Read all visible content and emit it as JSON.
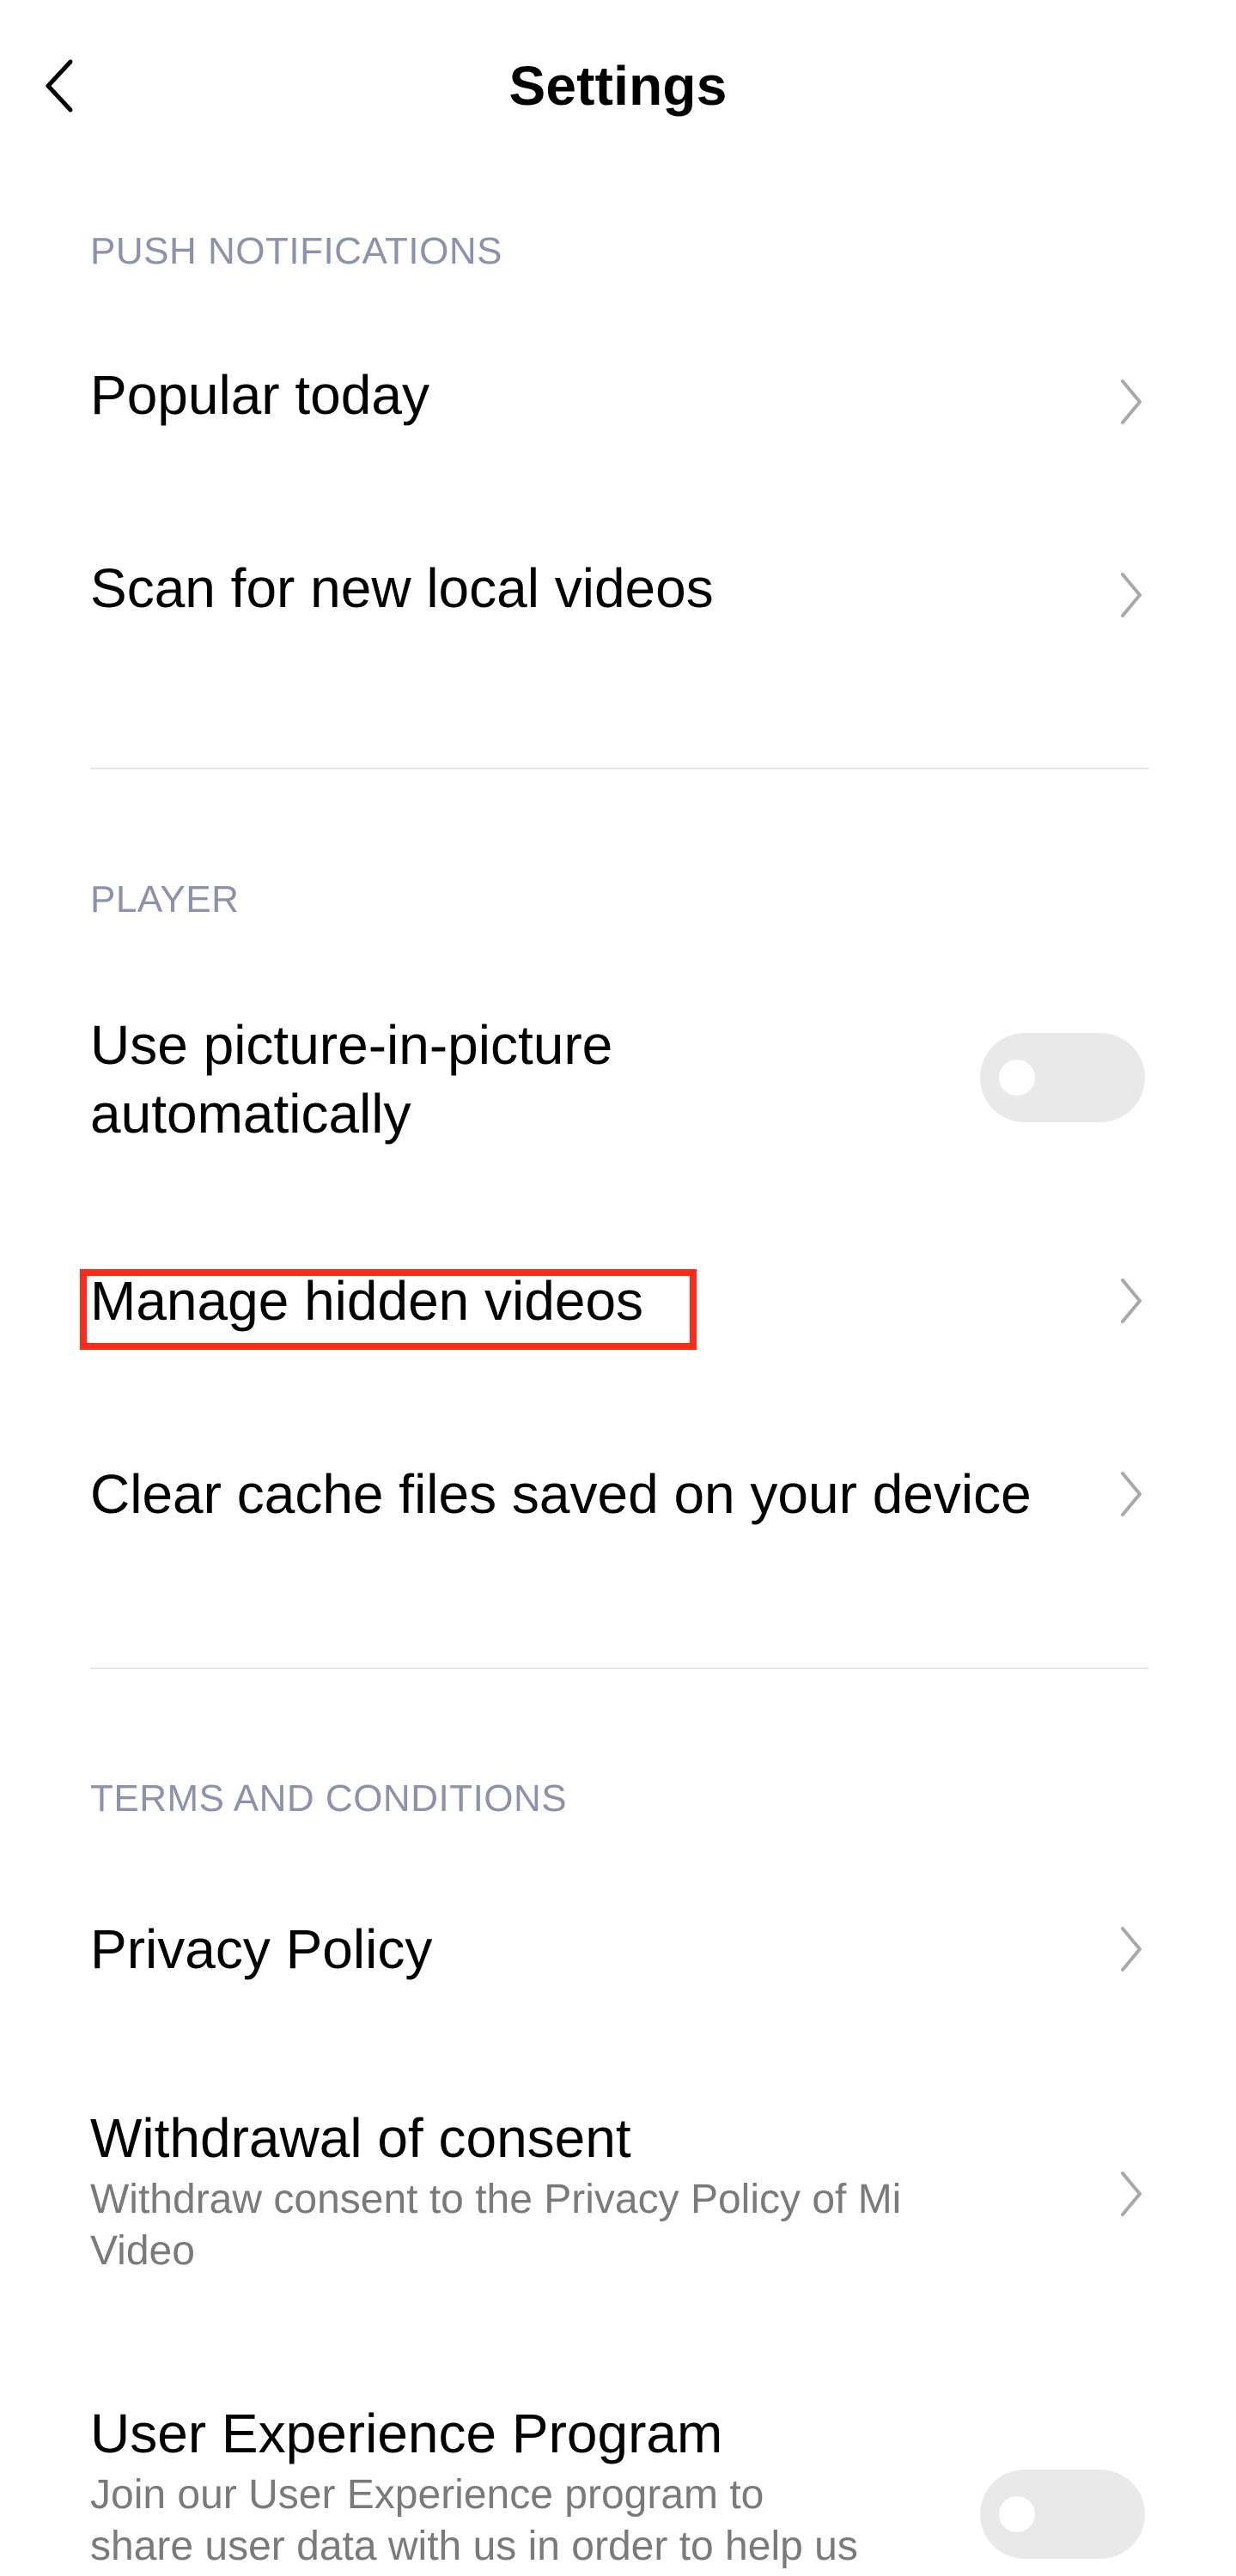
{
  "header": {
    "title": "Settings"
  },
  "sections": {
    "push": {
      "label": "PUSH NOTIFICATIONS",
      "items": [
        {
          "title": "Popular today"
        },
        {
          "title": "Scan for new local videos"
        }
      ]
    },
    "player": {
      "label": "PLAYER",
      "items": [
        {
          "title": "Use picture-in-picture automatically",
          "line1": "Use picture-in-picture",
          "line2": "automatically",
          "toggle": "off"
        },
        {
          "title": "Manage hidden videos"
        },
        {
          "title": "Clear cache files saved on your device"
        }
      ]
    },
    "terms": {
      "label": "TERMS AND CONDITIONS",
      "items": [
        {
          "title": "Privacy Policy"
        },
        {
          "title": "Withdrawal of consent",
          "subtitle_line1": "Withdraw consent to the Privacy Policy of Mi",
          "subtitle_line2": "Video"
        },
        {
          "title": "User Experience Program",
          "subtitle_line1": "Join our User Experience program to",
          "subtitle_line2": "share user data with us in order to help us",
          "toggle": "off"
        }
      ]
    }
  },
  "icons": {
    "back": "chevron-left-icon",
    "chevron": "chevron-right-icon"
  },
  "colors": {
    "section_label": "#8c91ad",
    "divider": "#e5e5e5",
    "toggle_off": "#e9e9e9",
    "highlight": "#ff2b1a"
  }
}
